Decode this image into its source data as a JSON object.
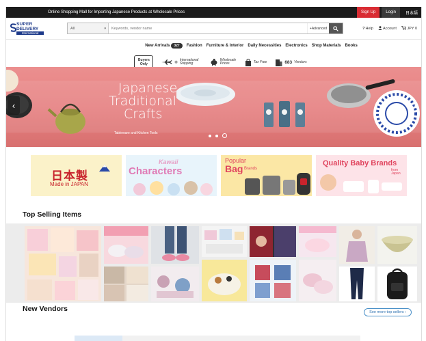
{
  "topbar": {
    "tagline": "Online Shopping Mall for Importing Japanese Products at Wholesale Prices",
    "signup": "Sign Up",
    "login": "Login",
    "language": "日本語"
  },
  "logo": {
    "line1": "SUPER",
    "line2": "DELIVERY",
    "line3": "International"
  },
  "search": {
    "category": "All",
    "placeholder": "Keywords, vendor name",
    "advanced": "+Advanced"
  },
  "header_links": {
    "help": "Help",
    "account": "Account",
    "cart": "JPY 0"
  },
  "nav": {
    "new_arrivals": "New Arrivals",
    "new_count": "327",
    "items": [
      "Fashion",
      "Furniture & Interior",
      "Daily Necessities",
      "Electronics",
      "Shop Materials",
      "Books"
    ]
  },
  "features": {
    "buyers_only": "Buyers Only",
    "international_shipping": "International Shipping",
    "wholesale_prices": "Wholesale Prices",
    "tax_free": "Tax Free",
    "vendors_count": "683",
    "vendors_label": "Vendors"
  },
  "hero": {
    "title_line1": "Japanese",
    "title_line2": "Traditional",
    "title_line3": "Crafts",
    "subtitle": "Tableware and Kitchen Tools"
  },
  "banners": {
    "made_in_japan_jp": "日本製",
    "made_in_japan_en": "Made in JAPAN",
    "characters_small": "Kawaii",
    "characters": "Characters",
    "popular": "Popular",
    "bag": "Bag",
    "brands": "Brands",
    "baby": "Quality Baby Brands",
    "from_japan": "from Japan"
  },
  "sections": {
    "top_selling": "Top Selling Items",
    "see_more": "See more top sellers",
    "new_vendors": "New Vendors"
  },
  "colors": {
    "topbar": "#1b1b1b",
    "signup": "#d92c33",
    "hero": "#e57f80",
    "brand_blue": "#1d3a8a",
    "link_blue": "#2a6fb0"
  }
}
